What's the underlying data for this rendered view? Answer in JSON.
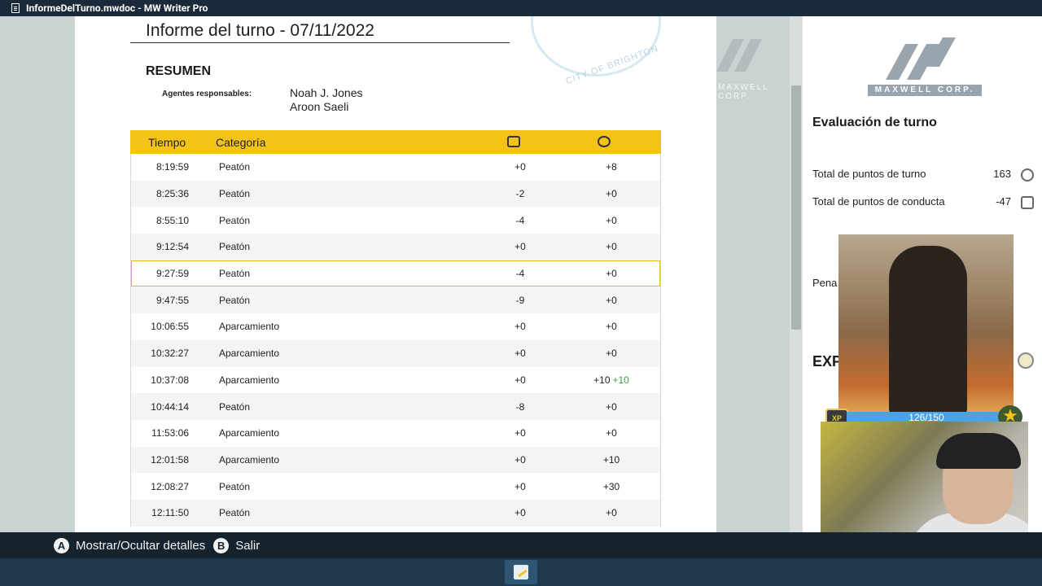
{
  "window": {
    "title": "InformeDelTurno.mwdoc - MW Writer Pro",
    "icon": "document-icon"
  },
  "document": {
    "title": "Informe del turno - 07/11/2022",
    "stamp_text": "CITY OF BRIGHTON",
    "summary_heading": "RESUMEN",
    "agents_label": "Agentes responsables:",
    "agents": [
      "Noah J. Jones",
      "Aroon Saeli"
    ],
    "table": {
      "headers": {
        "time": "Tiempo",
        "category": "Categoría",
        "conduct_icon": "shield-icon",
        "xp_icon": "xp-badge-icon"
      },
      "rows": [
        {
          "time": "8:19:59",
          "category": "Peatón",
          "conduct": "+0",
          "points": "+8",
          "bonus": ""
        },
        {
          "time": "8:25:36",
          "category": "Peatón",
          "conduct": "-2",
          "points": "+0",
          "bonus": ""
        },
        {
          "time": "8:55:10",
          "category": "Peatón",
          "conduct": "-4",
          "points": "+0",
          "bonus": ""
        },
        {
          "time": "9:12:54",
          "category": "Peatón",
          "conduct": "+0",
          "points": "+0",
          "bonus": ""
        },
        {
          "time": "9:27:59",
          "category": "Peatón",
          "conduct": "-4",
          "points": "+0",
          "bonus": "",
          "selected": true
        },
        {
          "time": "9:47:55",
          "category": "Peatón",
          "conduct": "-9",
          "points": "+0",
          "bonus": ""
        },
        {
          "time": "10:06:55",
          "category": "Aparcamiento",
          "conduct": "+0",
          "points": "+0",
          "bonus": ""
        },
        {
          "time": "10:32:27",
          "category": "Aparcamiento",
          "conduct": "+0",
          "points": "+0",
          "bonus": ""
        },
        {
          "time": "10:37:08",
          "category": "Aparcamiento",
          "conduct": "+0",
          "points": "+10",
          "bonus": "+10"
        },
        {
          "time": "10:44:14",
          "category": "Peatón",
          "conduct": "-8",
          "points": "+0",
          "bonus": ""
        },
        {
          "time": "11:53:06",
          "category": "Aparcamiento",
          "conduct": "+0",
          "points": "+0",
          "bonus": ""
        },
        {
          "time": "12:01:58",
          "category": "Aparcamiento",
          "conduct": "+0",
          "points": "+10",
          "bonus": ""
        },
        {
          "time": "12:08:27",
          "category": "Peatón",
          "conduct": "+0",
          "points": "+30",
          "bonus": ""
        },
        {
          "time": "12:11:50",
          "category": "Peatón",
          "conduct": "+0",
          "points": "+0",
          "bonus": ""
        }
      ]
    }
  },
  "panel": {
    "logo_text": "MAXWELL CORP.",
    "eval_title": "Evaluación de turno",
    "stats": [
      {
        "label": "Total de puntos de turno",
        "value": "163",
        "icon": "xp-badge-icon"
      },
      {
        "label": "Total de puntos de conducta",
        "value": "-47",
        "icon": "shield-icon"
      }
    ],
    "penalty_label_partial": "Pena",
    "exp_label_partial": "EXP",
    "xp_progress": "126/150",
    "xp_fraction": 0.84
  },
  "hints": [
    {
      "button": "A",
      "label": "Mostrar/Ocultar detalles"
    },
    {
      "button": "B",
      "label": "Salir"
    }
  ],
  "colors": {
    "accent": "#f5c317",
    "bonus": "#2fa83a",
    "titlebar": "#1b2a3a",
    "taskbar": "#1f3a4f"
  }
}
